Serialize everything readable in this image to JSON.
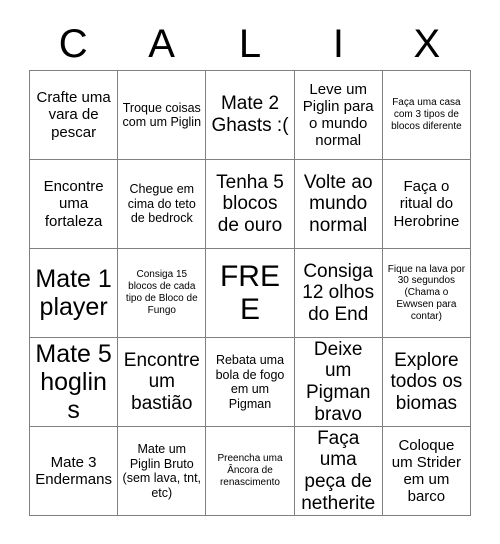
{
  "card": {
    "header_letters": [
      "C",
      "A",
      "L",
      "I",
      "X"
    ],
    "rows": [
      [
        {
          "text": "Crafte uma vara de pescar",
          "size": "fs-m"
        },
        {
          "text": "Troque coisas com um Piglin",
          "size": "fs-s"
        },
        {
          "text": "Mate 2 Ghasts :(",
          "size": "fs-l"
        },
        {
          "text": "Leve um Piglin para o mundo normal",
          "size": "fs-m"
        },
        {
          "text": "Faça uma casa com 3 tipos de blocos diferente",
          "size": "fs-xs"
        }
      ],
      [
        {
          "text": "Encontre uma fortaleza",
          "size": "fs-m"
        },
        {
          "text": "Chegue em cima do teto de bedrock",
          "size": "fs-s"
        },
        {
          "text": "Tenha 5 blocos de ouro",
          "size": "fs-l"
        },
        {
          "text": "Volte ao mundo normal",
          "size": "fs-l"
        },
        {
          "text": "Faça o ritual do Herobrine",
          "size": "fs-m"
        }
      ],
      [
        {
          "text": "Mate 1 player",
          "size": "fs-xl"
        },
        {
          "text": "Consiga 15 blocos de cada tipo de Bloco de Fungo",
          "size": "fs-xs"
        },
        {
          "text": "FREE",
          "size": "fs-free"
        },
        {
          "text": "Consiga 12 olhos do End",
          "size": "fs-l"
        },
        {
          "text": "Fique na lava por 30 segundos (Chama o Ewwsen para contar)",
          "size": "fs-xs"
        }
      ],
      [
        {
          "text": "Mate 5 hoglins",
          "size": "fs-xl"
        },
        {
          "text": "Encontre um bastião",
          "size": "fs-l"
        },
        {
          "text": "Rebata uma bola de fogo em um Pigman",
          "size": "fs-s"
        },
        {
          "text": "Deixe um Pigman bravo",
          "size": "fs-l"
        },
        {
          "text": "Explore todos os biomas",
          "size": "fs-l"
        }
      ],
      [
        {
          "text": "Mate 3 Endermans",
          "size": "fs-m"
        },
        {
          "text": "Mate um Piglin Bruto (sem lava, tnt, etc)",
          "size": "fs-s"
        },
        {
          "text": "Preencha uma Âncora de renascimento",
          "size": "fs-xs"
        },
        {
          "text": "Faça uma peça de netherite",
          "size": "fs-l"
        },
        {
          "text": "Coloque um Strider em um barco",
          "size": "fs-m"
        }
      ]
    ]
  },
  "colors": {
    "background": "#ffffff",
    "grid_line": "#808080",
    "text": "#000000"
  }
}
